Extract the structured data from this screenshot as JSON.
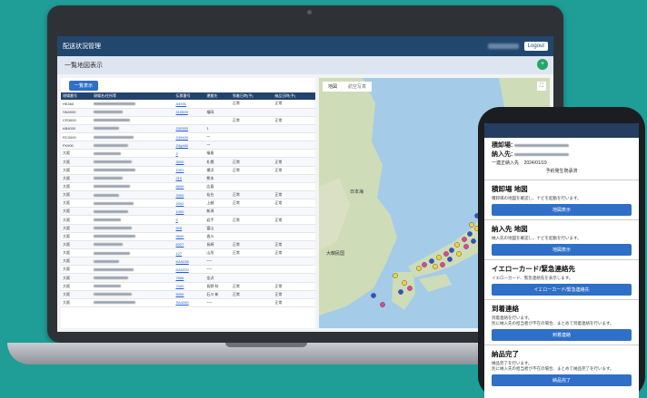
{
  "app": {
    "title": "配送状況管理",
    "logout_label": "Logout",
    "subtitle": "一覧地図表示",
    "fab_label": "+",
    "list_button": "一覧表示"
  },
  "table": {
    "headers": [
      "現場番号",
      "現場名/住所等",
      "伝票番号",
      "運搬先",
      "到着日時(予)",
      "納品日時(予)"
    ],
    "rows": [
      [
        "HE460",
        "",
        "A4931",
        "",
        "正常",
        "正常"
      ],
      [
        "SN4930",
        "",
        "410000",
        "福岡",
        "",
        ""
      ],
      [
        "CR3000",
        "",
        "",
        "",
        "正常",
        "正常"
      ],
      [
        "AB4000",
        "",
        "Z49300",
        "1",
        "",
        ""
      ],
      [
        "RC0000",
        "",
        "Z49400",
        "一",
        "",
        ""
      ],
      [
        "FK900",
        "",
        "Z4g460",
        "一",
        "",
        ""
      ],
      [
        "大阪",
        "",
        "2",
        "福島",
        "",
        ""
      ],
      [
        "大阪",
        "",
        "3000",
        "札幌",
        "正常",
        "正常"
      ],
      [
        "大阪",
        "",
        "1001",
        "横浜",
        "正常",
        "正常"
      ],
      [
        "大阪",
        "",
        "210",
        "熊本",
        "",
        ""
      ],
      [
        "大阪",
        "",
        "6600",
        "広島",
        "",
        ""
      ],
      [
        "大阪",
        "",
        "3300",
        "仙台",
        "正常",
        "正常"
      ],
      [
        "大阪",
        "",
        "2002",
        "上越",
        "正常",
        "正常"
      ],
      [
        "大阪",
        "",
        "1000",
        "新潟",
        "",
        ""
      ],
      [
        "大阪",
        "",
        "5",
        "岩手",
        "正常",
        "正常"
      ],
      [
        "大阪",
        "",
        "505",
        "富山",
        "",
        ""
      ],
      [
        "大阪",
        "",
        "9600",
        "香川",
        "",
        ""
      ],
      [
        "大阪",
        "",
        "6027",
        "長崎",
        "正常",
        "正常"
      ],
      [
        "大阪",
        "",
        "127",
        "山形",
        "正常",
        "正常"
      ],
      [
        "大阪",
        "",
        "KA4235",
        "ｰｰｰ",
        "",
        ""
      ],
      [
        "大阪",
        "",
        "KA0220",
        "ｰｰｰ",
        "",
        ""
      ],
      [
        "大阪",
        "",
        "7656",
        "金沢",
        "",
        ""
      ],
      [
        "大阪",
        "",
        "7000",
        "長野 秋",
        "正常",
        "正常"
      ],
      [
        "大阪",
        "",
        "5000",
        "石川 新",
        "正常",
        "正常"
      ],
      [
        "大阪",
        "",
        "SA4260",
        "ｰｰｰ",
        "",
        "正常"
      ]
    ]
  },
  "map": {
    "tabs": [
      "地図",
      "航空写真"
    ],
    "labels": {
      "sea": "日本海",
      "korea": "大韓民国"
    }
  },
  "phone": {
    "dest1_label": "積卸場:",
    "dest2_label": "納入先:",
    "date_label": "一連正納入先",
    "date": "2024/01/19",
    "status": "予約発生既承済",
    "sections": [
      {
        "title": "積卸場 地図",
        "desc": "積卸場の地図を確認し、ナビを起動を行います。",
        "button": "地図表示"
      },
      {
        "title": "納入先 地図",
        "desc": "納入先の地図を確認し、ナビを起動を行います。",
        "button": "地図表示"
      },
      {
        "title": "イエローカード/緊急連絡先",
        "desc": "イエローカード、緊急連絡先を表示します。",
        "button": "イエローカード/緊急連絡先"
      },
      {
        "title": "到着連絡",
        "desc": "到着連絡を行います。\n別に納入先の担当者が不在の場合、まとめて到着連絡を行います。",
        "button": "到着連絡"
      },
      {
        "title": "納品完了",
        "desc": "納品完了を行います。\n別に納入先の担当者が不在の場合、まとめて納品完了を行います。",
        "button": "納品完了"
      }
    ]
  },
  "colors": {
    "header": "#22476f",
    "accent": "#2f6fc7",
    "success": "#25a56a",
    "marker_pink": "#e0449a",
    "marker_yellow": "#f2d23a",
    "marker_blue": "#3053c8"
  }
}
